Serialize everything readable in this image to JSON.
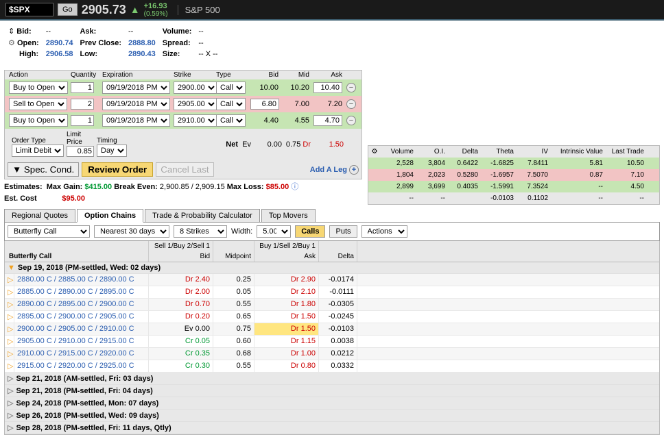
{
  "header": {
    "symbol": "$SPX",
    "go": "Go",
    "price": "2905.73",
    "change": "+16.93",
    "change_pct": "(0.59%)",
    "name": "S&P 500"
  },
  "quote": {
    "bid_lbl": "Bid:",
    "bid": "--",
    "ask_lbl": "Ask:",
    "ask": "--",
    "vol_lbl": "Volume:",
    "vol": "--",
    "open_lbl": "Open:",
    "open": "2890.74",
    "pclose_lbl": "Prev Close:",
    "pclose": "2888.80",
    "spread_lbl": "Spread:",
    "spread": "--",
    "high_lbl": "High:",
    "high": "2906.58",
    "low_lbl": "Low:",
    "low": "2890.43",
    "size_lbl": "Size:",
    "size": "-- X --"
  },
  "leg_hdr": {
    "action": "Action",
    "qty": "Quantity",
    "exp": "Expiration",
    "strike": "Strike",
    "type": "Type",
    "bid": "Bid",
    "mid": "Mid",
    "ask": "Ask"
  },
  "legs": [
    {
      "cls": "row-green",
      "action": "Buy to Open",
      "qty": "1",
      "exp": "09/19/2018 PM",
      "strike": "2900.00",
      "type": "Call",
      "bid": "10.00",
      "mid": "10.20",
      "ask": "10.40"
    },
    {
      "cls": "row-red",
      "action": "Sell to Open",
      "qty": "2",
      "exp": "09/19/2018 PM",
      "strike": "2905.00",
      "type": "Call",
      "bid": "6.80",
      "mid": "7.00",
      "ask": "7.20"
    },
    {
      "cls": "row-green",
      "action": "Buy to Open",
      "qty": "1",
      "exp": "09/19/2018 PM",
      "strike": "2910.00",
      "type": "Call",
      "bid": "4.40",
      "mid": "4.55",
      "ask": "4.70"
    }
  ],
  "net": {
    "lbl": "Net",
    "ev": "Ev",
    "bid": "0.00",
    "mid": "0.75",
    "dr": "Dr",
    "ask": "1.50"
  },
  "order_opts": {
    "otype_lbl": "Order Type",
    "otype": "Limit Debit",
    "lp_lbl": "Limit Price",
    "lp": "0.85",
    "tim_lbl": "Timing",
    "tim": "Day"
  },
  "btns": {
    "spec": "▼ Spec. Cond.",
    "review": "Review Order",
    "cancel": "Cancel Last",
    "addleg": "Add A Leg"
  },
  "est": {
    "lbl": "Estimates:",
    "mg_lbl": "Max Gain:",
    "mg": "$415.00",
    "be_lbl": "Break Even:",
    "be": "2,900.85 / 2,909.15",
    "ml_lbl": "Max Loss:",
    "ml": "$85.00",
    "cost_lbl": "Est. Cost",
    "cost": "$95.00"
  },
  "greeks_hdr": {
    "vol": "Volume",
    "oi": "O.I.",
    "delta": "Delta",
    "theta": "Theta",
    "iv": "IV",
    "intr": "Intrinsic Value",
    "last": "Last Trade"
  },
  "greeks": [
    {
      "cls": "g-green",
      "v": "2,528",
      "o": "3,804",
      "d": "0.6422",
      "t": "-1.6825",
      "i": "7.8411",
      "iv": "5.81",
      "l": "10.50"
    },
    {
      "cls": "g-red",
      "v": "1,804",
      "o": "2,023",
      "d": "0.5280",
      "t": "-1.6957",
      "i": "7.5070",
      "iv": "0.87",
      "l": "7.10"
    },
    {
      "cls": "g-green",
      "v": "2,899",
      "o": "3,699",
      "d": "0.4035",
      "t": "-1.5991",
      "i": "7.3524",
      "iv": "--",
      "l": "4.50"
    },
    {
      "cls": "",
      "v": "--",
      "o": "--",
      "d": "",
      "t": "-0.0103",
      "i": "0.1102",
      "iv": "--",
      "l": "--"
    }
  ],
  "tabs": {
    "rq": "Regional Quotes",
    "oc": "Option Chains",
    "tp": "Trade & Probability Calculator",
    "tm": "Top Movers"
  },
  "toolbar": {
    "strategy": "Butterfly Call",
    "exp": "Nearest 30 days",
    "strikes": "8 Strikes",
    "width_lbl": "Width:",
    "width": "5.00",
    "calls": "Calls",
    "puts": "Puts",
    "actions": "Actions"
  },
  "chain_hdr": {
    "strategy": "Butterfly Call",
    "s1": "Sell 1/Buy 2/Sell 1",
    "b1": "Buy 1/Sell 2/Buy 1",
    "bid": "Bid",
    "mid": "Midpoint",
    "ask": "Ask",
    "delta": "Delta"
  },
  "exp_open": "Sep 19, 2018 (PM-settled, Wed: 02 days)",
  "strikes": [
    {
      "name": "2880.00 C / 2885.00 C / 2890.00 C",
      "bid": "Dr 2.40",
      "mid": "0.25",
      "ask": "Dr 2.90",
      "d": "-0.0174",
      "bcls": "dr",
      "acls": "dr"
    },
    {
      "name": "2885.00 C / 2890.00 C / 2895.00 C",
      "bid": "Dr 2.00",
      "mid": "0.05",
      "ask": "Dr 2.10",
      "d": "-0.0111",
      "bcls": "dr",
      "acls": "dr"
    },
    {
      "name": "2890.00 C / 2895.00 C / 2900.00 C",
      "bid": "Dr 0.70",
      "mid": "0.55",
      "ask": "Dr 1.80",
      "d": "-0.0305",
      "bcls": "dr",
      "acls": "dr"
    },
    {
      "name": "2895.00 C / 2900.00 C / 2905.00 C",
      "bid": "Dr 0.20",
      "mid": "0.65",
      "ask": "Dr 1.50",
      "d": "-0.0245",
      "bcls": "dr",
      "acls": "dr"
    },
    {
      "name": "2900.00 C / 2905.00 C / 2910.00 C",
      "bid": "Ev 0.00",
      "mid": "0.75",
      "ask": "Dr 1.50",
      "d": "-0.0103",
      "bcls": "",
      "acls": "dr",
      "hl": "1"
    },
    {
      "name": "2905.00 C / 2910.00 C / 2915.00 C",
      "bid": "Cr 0.05",
      "mid": "0.60",
      "ask": "Dr 1.15",
      "d": "0.0038",
      "bcls": "cr",
      "acls": "dr"
    },
    {
      "name": "2910.00 C / 2915.00 C / 2920.00 C",
      "bid": "Cr 0.35",
      "mid": "0.68",
      "ask": "Dr 1.00",
      "d": "0.0212",
      "bcls": "cr",
      "acls": "dr"
    },
    {
      "name": "2915.00 C / 2920.00 C / 2925.00 C",
      "bid": "Cr 0.30",
      "mid": "0.55",
      "ask": "Dr 0.80",
      "d": "0.0332",
      "bcls": "cr",
      "acls": "dr"
    }
  ],
  "exp_closed": [
    "Sep 21, 2018 (AM-settled, Fri: 03 days)",
    "Sep 21, 2018 (PM-settled, Fri: 04 days)",
    "Sep 24, 2018 (PM-settled, Mon: 07 days)",
    "Sep 26, 2018 (PM-settled, Wed: 09 days)",
    "Sep 28, 2018 (PM-settled, Fri: 11 days, Qtly)"
  ]
}
